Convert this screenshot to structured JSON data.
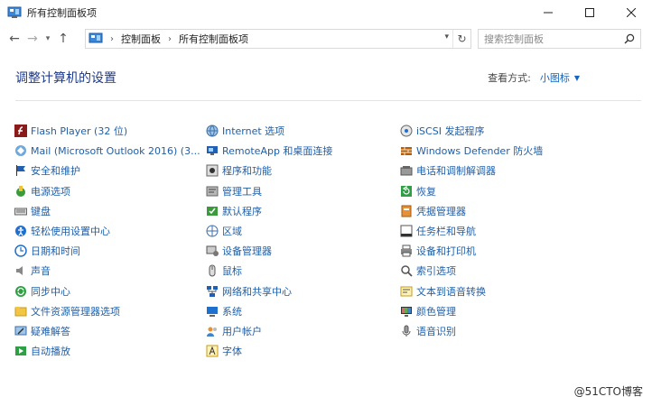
{
  "window": {
    "title": "所有控制面板项"
  },
  "nav": {
    "breadcrumbs": [
      "控制面板",
      "所有控制面板项"
    ],
    "search_placeholder": "搜索控制面板"
  },
  "header": {
    "heading": "调整计算机的设置",
    "view_label": "查看方式:",
    "view_value": "小图标"
  },
  "columns": [
    [
      {
        "label": "Flash Player (32 位)",
        "icon": "flash-icon"
      },
      {
        "label": "Mail (Microsoft Outlook 2016) (3...",
        "icon": "mail-icon"
      },
      {
        "label": "安全和维护",
        "icon": "flag-icon"
      },
      {
        "label": "电源选项",
        "icon": "power-icon"
      },
      {
        "label": "键盘",
        "icon": "keyboard-icon"
      },
      {
        "label": "轻松使用设置中心",
        "icon": "ease-of-access-icon"
      },
      {
        "label": "日期和时间",
        "icon": "clock-icon"
      },
      {
        "label": "声音",
        "icon": "speaker-icon"
      },
      {
        "label": "同步中心",
        "icon": "sync-icon"
      },
      {
        "label": "文件资源管理器选项",
        "icon": "folder-options-icon"
      },
      {
        "label": "疑难解答",
        "icon": "troubleshoot-icon"
      },
      {
        "label": "自动播放",
        "icon": "autoplay-icon"
      }
    ],
    [
      {
        "label": "Internet 选项",
        "icon": "internet-icon"
      },
      {
        "label": "RemoteApp 和桌面连接",
        "icon": "remoteapp-icon"
      },
      {
        "label": "程序和功能",
        "icon": "programs-icon"
      },
      {
        "label": "管理工具",
        "icon": "admin-tools-icon"
      },
      {
        "label": "默认程序",
        "icon": "default-programs-icon"
      },
      {
        "label": "区域",
        "icon": "region-icon"
      },
      {
        "label": "设备管理器",
        "icon": "device-manager-icon"
      },
      {
        "label": "鼠标",
        "icon": "mouse-icon"
      },
      {
        "label": "网络和共享中心",
        "icon": "network-icon"
      },
      {
        "label": "系统",
        "icon": "system-icon"
      },
      {
        "label": "用户帐户",
        "icon": "users-icon"
      },
      {
        "label": "字体",
        "icon": "font-icon"
      }
    ],
    [
      {
        "label": "iSCSI 发起程序",
        "icon": "iscsi-icon"
      },
      {
        "label": "Windows Defender 防火墙",
        "icon": "firewall-icon"
      },
      {
        "label": "电话和调制解调器",
        "icon": "phone-icon"
      },
      {
        "label": "恢复",
        "icon": "recovery-icon"
      },
      {
        "label": "凭据管理器",
        "icon": "credential-icon"
      },
      {
        "label": "任务栏和导航",
        "icon": "taskbar-icon"
      },
      {
        "label": "设备和打印机",
        "icon": "printer-icon"
      },
      {
        "label": "索引选项",
        "icon": "index-icon"
      },
      {
        "label": "文本到语音转换",
        "icon": "text-to-speech-icon"
      },
      {
        "label": "颜色管理",
        "icon": "color-management-icon"
      },
      {
        "label": "语音识别",
        "icon": "microphone-icon"
      }
    ]
  ],
  "watermark": "@51CTO博客",
  "colors": {
    "link": "#1f5fa8",
    "heading": "#1e3a8a",
    "accent": "#1565c0"
  }
}
